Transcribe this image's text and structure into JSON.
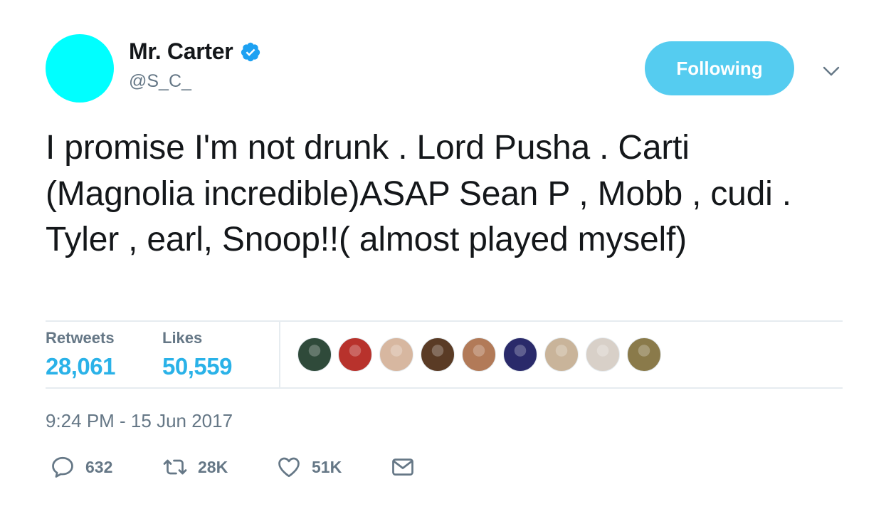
{
  "user": {
    "name": "Mr. Carter",
    "handle": "@S_C_",
    "avatar_color": "#00ffff",
    "verified_icon": "verified-badge-icon"
  },
  "follow_button": {
    "label": "Following",
    "color": "#55ccf0"
  },
  "tweet": {
    "text": "I promise I'm not drunk . Lord Pusha . Carti (Magnolia incredible)ASAP Sean P , Mobb , cudi . Tyler , earl, Snoop!!( almost played myself)"
  },
  "stats": {
    "retweets_label": "Retweets",
    "retweets_count": "28,061",
    "likes_label": "Likes",
    "likes_count": "50,559"
  },
  "likers": [
    {
      "icon": "liker-avatar-1",
      "color": "#2f4a3a"
    },
    {
      "icon": "liker-avatar-2",
      "color": "#b8322c"
    },
    {
      "icon": "liker-avatar-3",
      "color": "#d7b7a0"
    },
    {
      "icon": "liker-avatar-4",
      "color": "#5a3b25"
    },
    {
      "icon": "liker-avatar-5",
      "color": "#b27a58"
    },
    {
      "icon": "liker-avatar-6",
      "color": "#2a2a6a"
    },
    {
      "icon": "liker-avatar-7",
      "color": "#c9b49a"
    },
    {
      "icon": "liker-avatar-8",
      "color": "#d8d0c8"
    },
    {
      "icon": "liker-avatar-9",
      "color": "#8a7a4a"
    }
  ],
  "timestamp": "9:24 PM - 15 Jun 2017",
  "actions": {
    "reply_count": "632",
    "retweet_count": "28K",
    "like_count": "51K"
  },
  "colors": {
    "link_blue": "#1da1f2",
    "muted_gray": "#657786",
    "divider": "#e6ecf0"
  }
}
